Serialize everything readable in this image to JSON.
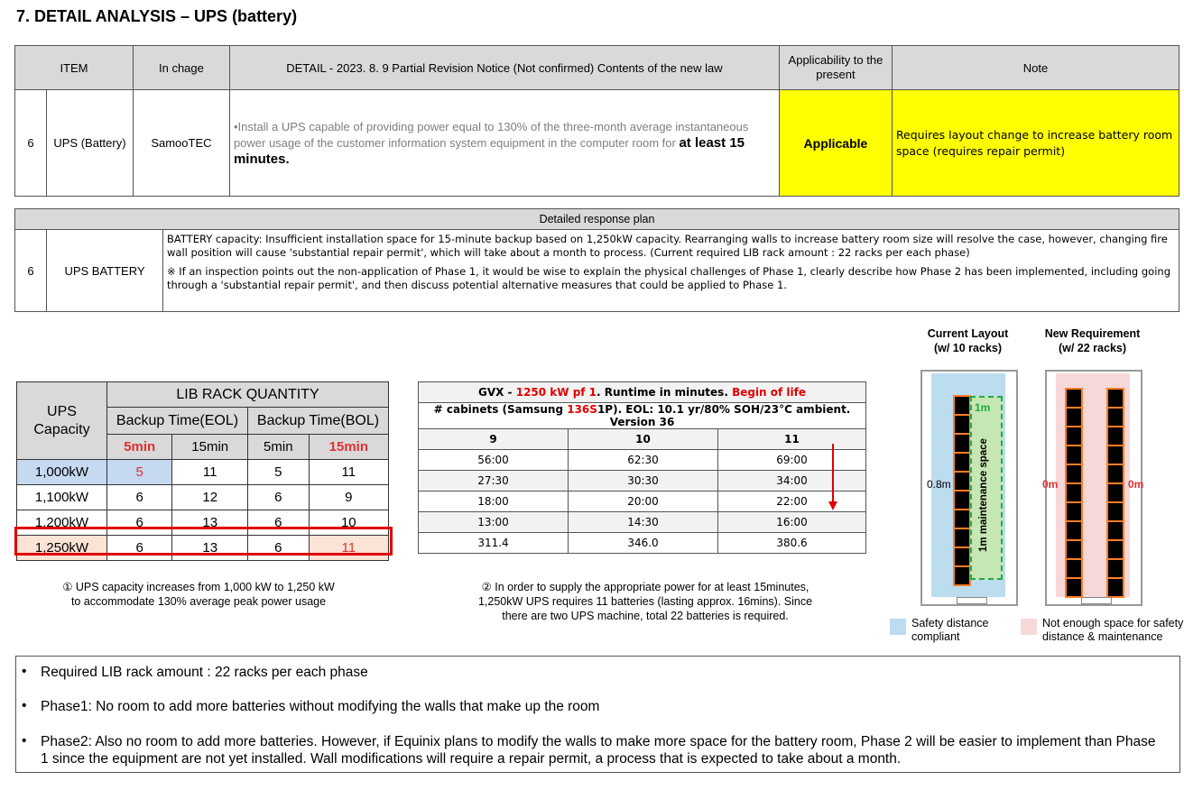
{
  "title": "7. DETAIL ANALYSIS – UPS (battery)",
  "detail_table": {
    "headers": [
      "ITEM",
      "In chage",
      "DETAIL - 2023. 8. 9 Partial Revision Notice (Not confirmed) Contents of the new law",
      "Applicability to the present",
      "Note"
    ],
    "row": {
      "no": "6",
      "item": "UPS (Battery)",
      "in_charge": "SamooTEC",
      "detail_gray": "•Install a UPS capable of providing power equal to 130% of the three-month average instantaneous power usage of the customer information system equipment in the computer room for ",
      "detail_bold": "at least 15 minutes.",
      "applicability": "Applicable",
      "note": "Requires layout change to increase battery room space (requires repair permit)"
    }
  },
  "plan_table": {
    "header": "Detailed response plan",
    "no": "6",
    "item": "UPS BATTERY",
    "para1": "BATTERY capacity: Insufficient installation space for 15-minute backup based on 1,250kW capacity. Rearranging walls to increase battery room size will resolve the case, however, changing fire wall position will cause 'substantial repair permit', which will take about a month to process.  (Current required LIB rack amount : 22 racks per each phase)",
    "para2": "※ If an inspection points out the non-application of Phase 1, it would be wise to explain the physical challenges of Phase 1, clearly describe how Phase 2 has been implemented, including going through a 'substantial repair permit', and then discuss potential alternative measures that could be applied to Phase 1."
  },
  "lib_table": {
    "corner": "UPS Capacity",
    "group_header": "LIB RACK QUANTITY",
    "sub_eol": "Backup Time(EOL)",
    "sub_bol": "Backup Time(BOL)",
    "times": [
      "5min",
      "15min",
      "5min",
      "15min"
    ],
    "rows": [
      {
        "cap": "1,000kW",
        "v": [
          "5",
          "11",
          "5",
          "11"
        ]
      },
      {
        "cap": "1,100kW",
        "v": [
          "6",
          "12",
          "6",
          "9"
        ]
      },
      {
        "cap": "1,200kW",
        "v": [
          "6",
          "13",
          "6",
          "10"
        ]
      },
      {
        "cap": "1,250kW",
        "v": [
          "6",
          "13",
          "6",
          "11"
        ]
      }
    ]
  },
  "gvx_table": {
    "line1_a": "GVX - ",
    "line1_b": "1250 kW pf 1",
    "line1_c": ". Runtime in minutes. ",
    "line1_d": "Begin of life",
    "line2_a": "# cabinets (Samsung ",
    "line2_b": "136S",
    "line2_c": "1P). EOL: 10.1 yr/80% SOH/23°C ambient. Version 36",
    "cols": [
      "9",
      "10",
      "11"
    ],
    "rows": [
      [
        "56:00",
        "62:30",
        "69:00"
      ],
      [
        "27:30",
        "30:30",
        "34:00"
      ],
      [
        "18:00",
        "20:00",
        "22:00"
      ],
      [
        "13:00",
        "14:30",
        "16:00"
      ],
      [
        "311.4",
        "346.0",
        "380.6"
      ]
    ]
  },
  "captions": {
    "c1_line1": "① UPS capacity increases from 1,000 kW to 1,250 kW",
    "c1_line2": "to accommodate 130% average peak power usage",
    "c2_line1": "② In order to supply the appropriate power for at least 15minutes,",
    "c2_line2": "1,250kW UPS requires 11 batteries (lasting approx. 16mins). Since",
    "c2_line3": "there are two UPS machine, total 22 batteries is required."
  },
  "layouts": {
    "current_title1": "Current Layout",
    "current_title2": "(w/ 10 racks)",
    "new_title1": "New Requirement",
    "new_title2": "(w/ 22 racks)",
    "current_side": "0.8m",
    "maint_top": "1m",
    "maint_label": "1m maintenance space",
    "new_left": "0m",
    "new_right": "0m",
    "legend_green_1": "Safety distance",
    "legend_green_2": "compliant",
    "legend_red_1": "Not enough space for safety",
    "legend_red_2": "distance & maintenance",
    "colors": {
      "blue": "#bcdcf0",
      "pink": "#f7d8d8",
      "rack_border": "#ff7f27"
    }
  },
  "bottom": {
    "b1": "Required LIB rack amount : 22 racks per each phase",
    "b2": "Phase1: No room to add more batteries without modifying the walls that make up the room",
    "b3": "Phase2: Also no room to add more batteries. However, if Equinix plans to modify the walls to make more space for the battery room, Phase 2 will be easier to implement than Phase 1 since the equipment are not yet installed. Wall modifications will require a repair permit, a process that is expected to take about a month."
  }
}
